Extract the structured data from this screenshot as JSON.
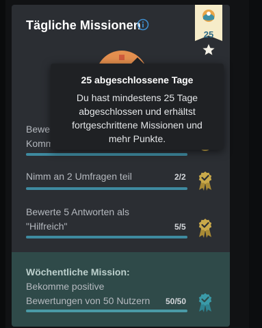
{
  "card": {
    "title": "Tägliche Missionen",
    "streak_badge": {
      "value": "25",
      "icon": "star-icon"
    }
  },
  "missions": [
    {
      "label_line1": "Bewerte",
      "label_line2": "Komm",
      "count": "",
      "progress": 1.0
    },
    {
      "label": "Nimm an 2 Umfragen teil",
      "count": "2/2",
      "progress": 1.0
    },
    {
      "label_line1": "Bewerte 5 Antworten als",
      "label_line2": "\"Hilfreich\"",
      "count": "5/5",
      "progress": 1.0
    }
  ],
  "weekly": {
    "title": "Wöchentliche Mission:",
    "label_line1": "Bekomme positive",
    "label_line2": "Bewertungen von 50 Nutzern",
    "count": "50/50",
    "progress": 1.0
  },
  "tooltip": {
    "title": "25 abgeschlossene Tage",
    "body": "Du hast mindestens 25 Tage abgeschlossen und erhältst fortgeschrittene Missionen und mehr Punkte."
  },
  "colors": {
    "card_bg": "#2b2e33",
    "tooltip_bg": "#1f2124",
    "bar_fill": "#3e8aa0",
    "badge_gold": "#c9a94a",
    "badge_teal": "#3a9aa8",
    "weekly_bg": "#2f4a49",
    "ribbon_bg": "#f6ecc9"
  }
}
